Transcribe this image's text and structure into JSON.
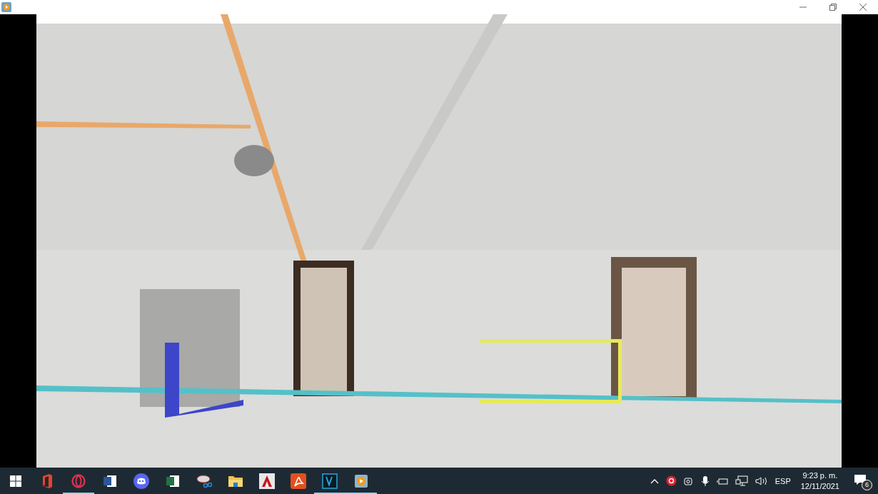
{
  "taskbar": {
    "apps": [
      {
        "kind": "office",
        "running": false
      },
      {
        "kind": "opera",
        "running": true
      },
      {
        "kind": "word",
        "running": false
      },
      {
        "kind": "discord",
        "running": false
      },
      {
        "kind": "excel",
        "running": false
      },
      {
        "kind": "snip",
        "running": false
      },
      {
        "kind": "folder",
        "running": false
      },
      {
        "kind": "autocad",
        "running": false
      },
      {
        "kind": "acrobat",
        "running": false
      },
      {
        "kind": "vegas",
        "running": true
      },
      {
        "kind": "player",
        "running": true
      }
    ],
    "language": "ESP",
    "time": "9:23 p. m.",
    "date": "12/11/2021",
    "notification_count": "6"
  }
}
